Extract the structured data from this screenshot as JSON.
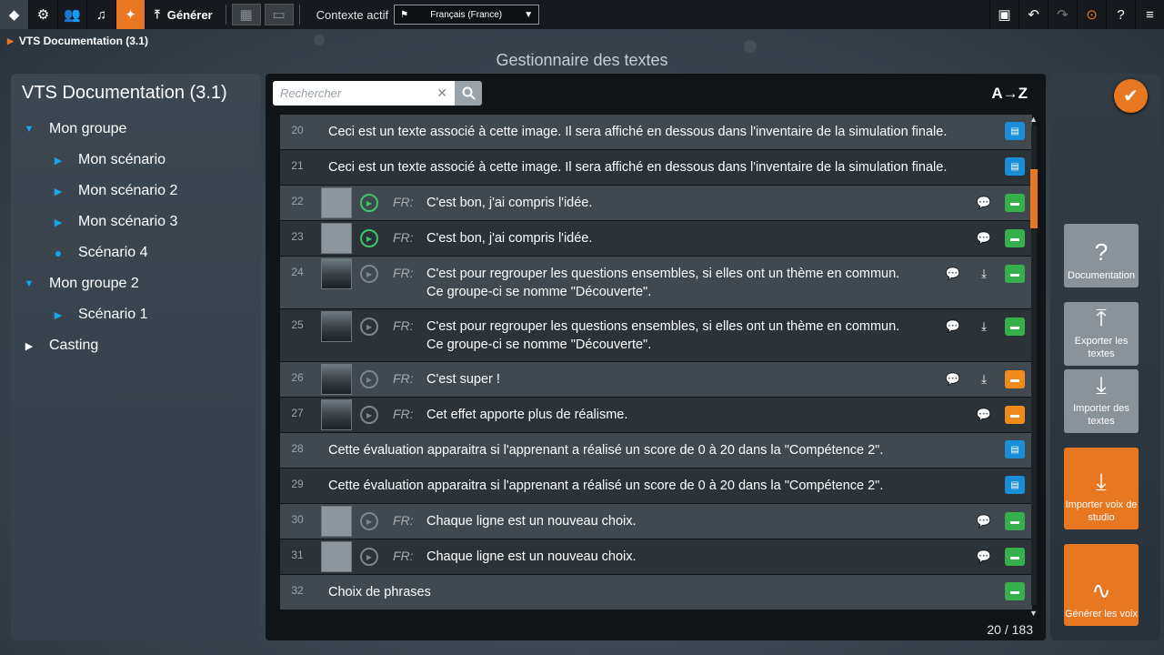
{
  "toolbar": {
    "generate_label": "Générer",
    "context_label": "Contexte actif",
    "context_value": "Français (France)"
  },
  "breadcrumb": "VTS Documentation (3.1)",
  "page_title": "Gestionnaire des textes",
  "tree": {
    "title": "VTS Documentation (3.1)",
    "items": [
      {
        "label": "Mon groupe",
        "level": 0,
        "state": "open"
      },
      {
        "label": "Mon scénario",
        "level": 1,
        "state": "closed"
      },
      {
        "label": "Mon scénario 2",
        "level": 1,
        "state": "closed"
      },
      {
        "label": "Mon scénario 3",
        "level": 1,
        "state": "closed"
      },
      {
        "label": "Scénario 4",
        "level": 1,
        "state": "selected"
      },
      {
        "label": "Mon groupe 2",
        "level": 0,
        "state": "open"
      },
      {
        "label": "Scénario 1",
        "level": 1,
        "state": "closed"
      },
      {
        "label": "Casting",
        "level": 0,
        "state": "closed-white"
      }
    ]
  },
  "search": {
    "placeholder": "Rechercher"
  },
  "sort_label": "A→Z",
  "rows": [
    {
      "num": "20",
      "kind": "plain",
      "text": "Ceci est un texte associé à cette image. Il sera affiché en dessous dans l'inventaire de la simulation finale.",
      "tag": "blue",
      "actions": []
    },
    {
      "num": "21",
      "kind": "plain",
      "text": "Ceci est un texte associé à cette image. Il sera affiché en dessous dans l'inventaire de la simulation finale.",
      "tag": "blue",
      "actions": []
    },
    {
      "num": "22",
      "kind": "dialog",
      "thumb": "generic",
      "play": "on",
      "lang": "FR:",
      "text": "C'est bon, j'ai compris l'idée.",
      "tag": "green",
      "actions": [
        "speech"
      ]
    },
    {
      "num": "23",
      "kind": "dialog",
      "thumb": "generic",
      "play": "on",
      "lang": "FR:",
      "text": "C'est bon, j'ai compris l'idée.",
      "tag": "green",
      "actions": [
        "speech"
      ]
    },
    {
      "num": "24",
      "kind": "dialog",
      "thumb": "man",
      "play": "off",
      "lang": "FR:",
      "text": "C'est pour regrouper les questions ensembles, si elles ont un thème en commun.",
      "text2": "Ce groupe-ci se nomme \"Découverte\".",
      "tag": "green",
      "actions": [
        "speech",
        "download"
      ]
    },
    {
      "num": "25",
      "kind": "dialog",
      "thumb": "man",
      "play": "off",
      "lang": "FR:",
      "text": "C'est pour regrouper les questions ensembles, si elles ont un thème en commun.",
      "text2": "Ce groupe-ci se nomme \"Découverte\".",
      "tag": "green",
      "actions": [
        "speech",
        "download"
      ]
    },
    {
      "num": "26",
      "kind": "dialog",
      "thumb": "man",
      "play": "off",
      "lang": "FR:",
      "text": "C'est super !",
      "tag": "orange",
      "actions": [
        "speech",
        "download"
      ]
    },
    {
      "num": "27",
      "kind": "dialog",
      "thumb": "man",
      "play": "off",
      "lang": "FR:",
      "text": "Cet effet apporte plus de réalisme.",
      "tag": "orange",
      "actions": [
        "speech"
      ]
    },
    {
      "num": "28",
      "kind": "plain",
      "text": "Cette évaluation apparaitra si l'apprenant a réalisé un score de 0 à 20 dans la \"Compétence 2\".",
      "tag": "blue",
      "actions": []
    },
    {
      "num": "29",
      "kind": "plain",
      "text": "Cette évaluation apparaitra si l'apprenant a réalisé un score de 0 à 20 dans la \"Compétence 2\".",
      "tag": "blue",
      "actions": []
    },
    {
      "num": "30",
      "kind": "dialog",
      "thumb": "generic",
      "play": "off",
      "lang": "FR:",
      "text": "Chaque ligne est un nouveau choix.",
      "tag": "green",
      "actions": [
        "speech"
      ]
    },
    {
      "num": "31",
      "kind": "dialog",
      "thumb": "generic",
      "play": "off",
      "lang": "FR:",
      "text": "Chaque ligne est un nouveau choix.",
      "tag": "green",
      "actions": [
        "speech"
      ]
    },
    {
      "num": "32",
      "kind": "plain",
      "text": "Choix de phrases",
      "tag": "green",
      "actions": []
    }
  ],
  "count": "20 / 183",
  "side_buttons": [
    {
      "label": "Documentation",
      "color": "gray",
      "icon": "help-doc-icon"
    },
    {
      "label": "Exporter les textes",
      "color": "gray",
      "icon": "upload-icon"
    },
    {
      "label": "Importer des textes",
      "color": "gray",
      "icon": "download-icon"
    },
    {
      "label": "Importer voix de studio",
      "color": "orange",
      "icon": "download-icon"
    },
    {
      "label": "Générer les voix",
      "color": "orange",
      "icon": "waveform-icon"
    }
  ],
  "colors": {
    "accent": "#e87722",
    "tree_icon": "#1aa3e8",
    "play_active": "#3cc46a"
  }
}
